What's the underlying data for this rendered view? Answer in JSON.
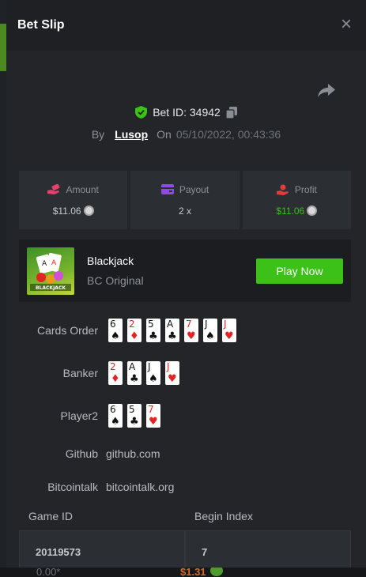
{
  "header": {
    "title": "Bet Slip",
    "close_symbol": "×"
  },
  "bet": {
    "id_label": "Bet ID: 34942",
    "by_label": "By",
    "user": "Lusop",
    "on_label": "On",
    "date": "05/10/2022, 00:43:36"
  },
  "stats": {
    "amount": {
      "label": "Amount",
      "value": "$11.06",
      "icon": "money-hand-icon"
    },
    "payout": {
      "label": "Payout",
      "value": "2 x",
      "icon": "wallet-card-icon"
    },
    "profit": {
      "label": "Profit",
      "value": "$11.06",
      "icon": "profit-hand-icon"
    }
  },
  "game": {
    "name": "Blackjack",
    "subtitle": "BC Original",
    "play_label": "Play Now",
    "thumb_text": "BLACKJACK"
  },
  "rows": {
    "cards_order": {
      "label": "Cards Order",
      "cards": [
        {
          "rank": "6",
          "suit": "♠",
          "color": "black"
        },
        {
          "rank": "2",
          "suit": "♦",
          "color": "red"
        },
        {
          "rank": "5",
          "suit": "♣",
          "color": "black"
        },
        {
          "rank": "A",
          "suit": "♣",
          "color": "black"
        },
        {
          "rank": "7",
          "suit": "♥",
          "color": "red"
        },
        {
          "rank": "J",
          "suit": "♠",
          "color": "black"
        },
        {
          "rank": "J",
          "suit": "♥",
          "color": "red"
        }
      ]
    },
    "banker": {
      "label": "Banker",
      "cards": [
        {
          "rank": "2",
          "suit": "♦",
          "color": "red"
        },
        {
          "rank": "A",
          "suit": "♣",
          "color": "black"
        },
        {
          "rank": "J",
          "suit": "♠",
          "color": "black"
        },
        {
          "rank": "J",
          "suit": "♥",
          "color": "red"
        }
      ]
    },
    "player2": {
      "label": "Player2",
      "cards": [
        {
          "rank": "6",
          "suit": "♠",
          "color": "black"
        },
        {
          "rank": "5",
          "suit": "♣",
          "color": "black"
        },
        {
          "rank": "7",
          "suit": "♥",
          "color": "red"
        }
      ]
    },
    "github": {
      "label": "Github",
      "value": "github.com"
    },
    "bitcointalk": {
      "label": "Bitcointalk",
      "value": "bitcointalk.org"
    }
  },
  "table": {
    "headers": [
      "Game ID",
      "Begin Index"
    ],
    "values": [
      "20119573",
      "7"
    ]
  },
  "background": {
    "bottom_text": "0.00*",
    "bottom_money": "$1.31"
  },
  "colors": {
    "accent_green": "#3bc117",
    "modal_bg": "#232529",
    "card_red": "#e42424"
  }
}
